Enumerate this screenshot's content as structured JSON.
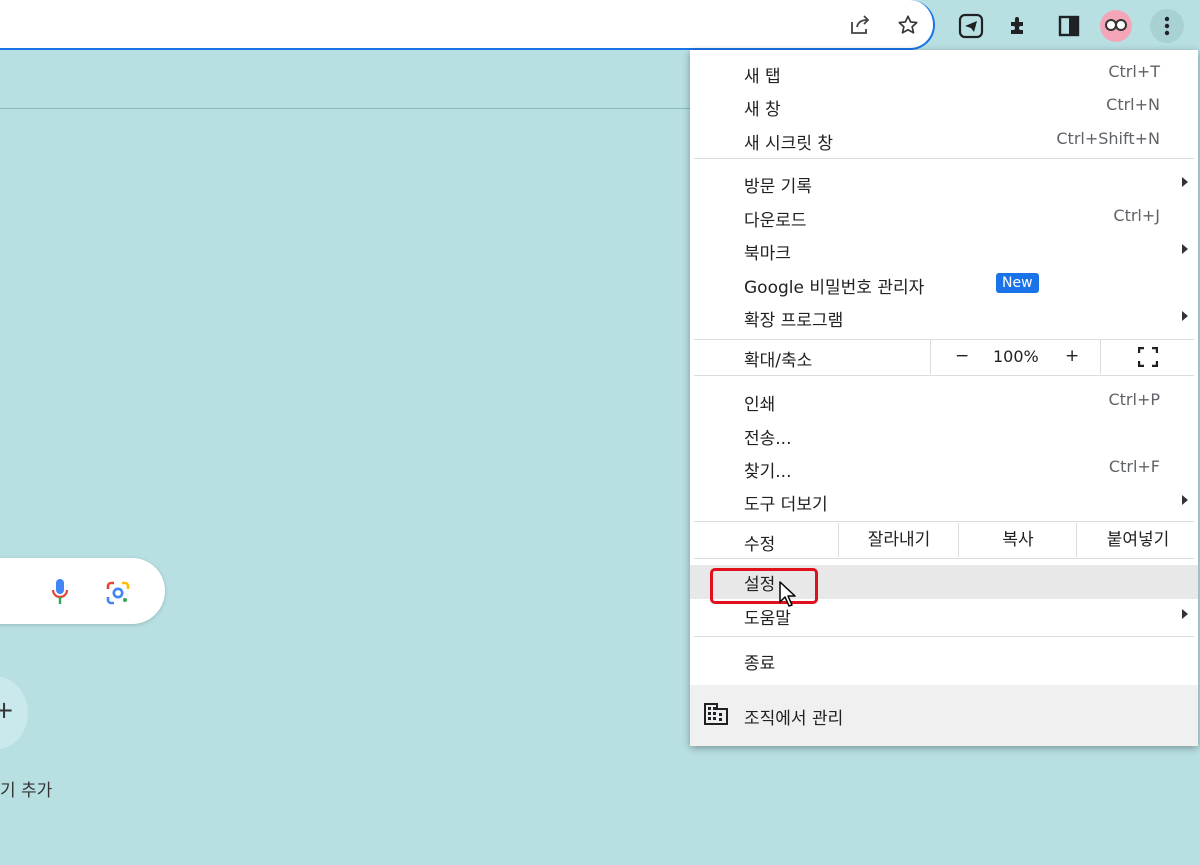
{
  "toolbar": {
    "icons": [
      "share-icon",
      "star-icon",
      "telegram-icon",
      "extensions-icon",
      "side-panel-icon",
      "profile-avatar",
      "more-menu-icon"
    ]
  },
  "ntp": {
    "shortcut_plus": "+",
    "shortcut_label": "기 추가",
    "icons": [
      "microphone-icon",
      "google-lens-icon"
    ]
  },
  "menu": {
    "new_tab": {
      "label": "새 탭",
      "shortcut": "Ctrl+T"
    },
    "new_window": {
      "label": "새 창",
      "shortcut": "Ctrl+N"
    },
    "incognito": {
      "label": "새 시크릿 창",
      "shortcut": "Ctrl+Shift+N"
    },
    "history": {
      "label": "방문 기록"
    },
    "downloads": {
      "label": "다운로드",
      "shortcut": "Ctrl+J"
    },
    "bookmarks": {
      "label": "북마크"
    },
    "password_manager": {
      "label": "Google 비밀번호 관리자",
      "badge": "New"
    },
    "extensions": {
      "label": "확장 프로그램"
    },
    "zoom": {
      "label": "확대/축소",
      "minus": "−",
      "value": "100%",
      "plus": "+"
    },
    "print": {
      "label": "인쇄",
      "shortcut": "Ctrl+P"
    },
    "cast": {
      "label": "전송..."
    },
    "find": {
      "label": "찾기...",
      "shortcut": "Ctrl+F"
    },
    "more_tools": {
      "label": "도구 더보기"
    },
    "edit": {
      "label": "수정",
      "cut": "잘라내기",
      "copy": "복사",
      "paste": "붙여넣기"
    },
    "settings": {
      "label": "설정"
    },
    "help": {
      "label": "도움말"
    },
    "exit": {
      "label": "종료"
    },
    "managed": {
      "label": "조직에서 관리"
    }
  },
  "colors": {
    "background": "#b8e0e3",
    "accent": "#1a73e8",
    "highlight": "#e0101c"
  }
}
